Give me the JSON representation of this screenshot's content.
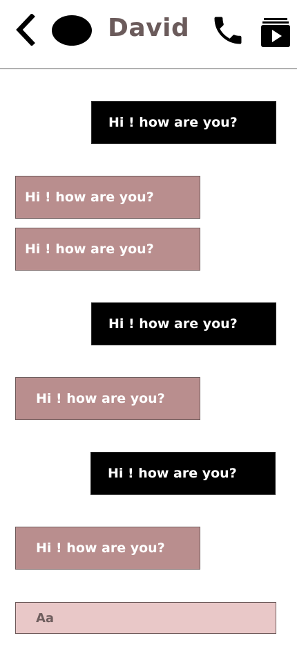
{
  "header": {
    "contact_name": "David",
    "icons": {
      "back": "chevron-left-icon",
      "avatar": "avatar",
      "call": "phone-icon",
      "media": "media-stack-icon"
    }
  },
  "messages": [
    {
      "direction": "outgoing",
      "text": "Hi ! how are you?"
    },
    {
      "direction": "incoming",
      "text": "Hi ! how are you?"
    },
    {
      "direction": "incoming",
      "text": "Hi ! how are you?"
    },
    {
      "direction": "outgoing",
      "text": "Hi ! how are you?"
    },
    {
      "direction": "incoming",
      "text": "Hi ! how are you?"
    },
    {
      "direction": "outgoing",
      "text": "Hi ! how are you?"
    },
    {
      "direction": "incoming",
      "text": "Hi ! how are you?"
    }
  ],
  "composer": {
    "placeholder": "Aa",
    "value": ""
  },
  "colors": {
    "outgoing_bubble": "#000000",
    "incoming_bubble": "#b98e8e",
    "composer_bg": "#e9c8c8",
    "name_text": "#6b5b5b"
  }
}
